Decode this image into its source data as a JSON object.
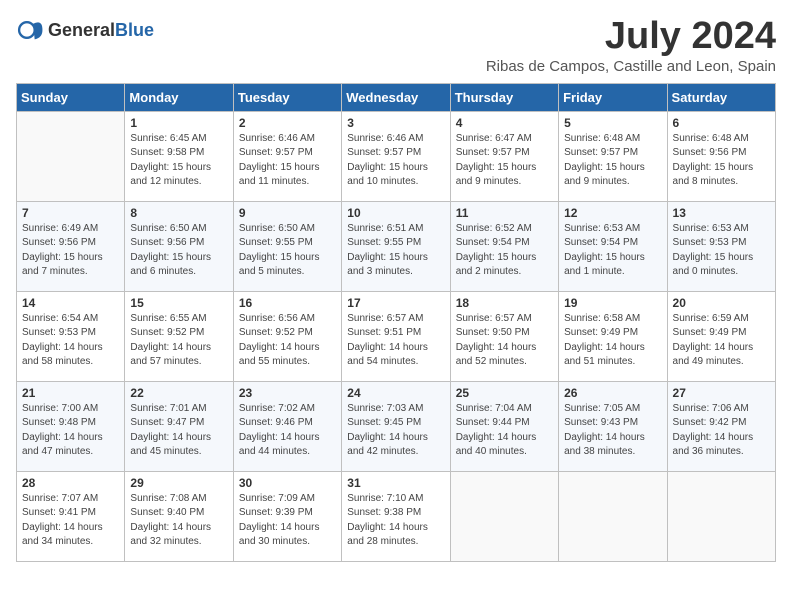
{
  "header": {
    "logo_general": "General",
    "logo_blue": "Blue",
    "month_title": "July 2024",
    "location": "Ribas de Campos, Castille and Leon, Spain"
  },
  "days_of_week": [
    "Sunday",
    "Monday",
    "Tuesday",
    "Wednesday",
    "Thursday",
    "Friday",
    "Saturday"
  ],
  "weeks": [
    [
      {
        "day": "",
        "info": ""
      },
      {
        "day": "1",
        "info": "Sunrise: 6:45 AM\nSunset: 9:58 PM\nDaylight: 15 hours\nand 12 minutes."
      },
      {
        "day": "2",
        "info": "Sunrise: 6:46 AM\nSunset: 9:57 PM\nDaylight: 15 hours\nand 11 minutes."
      },
      {
        "day": "3",
        "info": "Sunrise: 6:46 AM\nSunset: 9:57 PM\nDaylight: 15 hours\nand 10 minutes."
      },
      {
        "day": "4",
        "info": "Sunrise: 6:47 AM\nSunset: 9:57 PM\nDaylight: 15 hours\nand 9 minutes."
      },
      {
        "day": "5",
        "info": "Sunrise: 6:48 AM\nSunset: 9:57 PM\nDaylight: 15 hours\nand 9 minutes."
      },
      {
        "day": "6",
        "info": "Sunrise: 6:48 AM\nSunset: 9:56 PM\nDaylight: 15 hours\nand 8 minutes."
      }
    ],
    [
      {
        "day": "7",
        "info": "Sunrise: 6:49 AM\nSunset: 9:56 PM\nDaylight: 15 hours\nand 7 minutes."
      },
      {
        "day": "8",
        "info": "Sunrise: 6:50 AM\nSunset: 9:56 PM\nDaylight: 15 hours\nand 6 minutes."
      },
      {
        "day": "9",
        "info": "Sunrise: 6:50 AM\nSunset: 9:55 PM\nDaylight: 15 hours\nand 5 minutes."
      },
      {
        "day": "10",
        "info": "Sunrise: 6:51 AM\nSunset: 9:55 PM\nDaylight: 15 hours\nand 3 minutes."
      },
      {
        "day": "11",
        "info": "Sunrise: 6:52 AM\nSunset: 9:54 PM\nDaylight: 15 hours\nand 2 minutes."
      },
      {
        "day": "12",
        "info": "Sunrise: 6:53 AM\nSunset: 9:54 PM\nDaylight: 15 hours\nand 1 minute."
      },
      {
        "day": "13",
        "info": "Sunrise: 6:53 AM\nSunset: 9:53 PM\nDaylight: 15 hours\nand 0 minutes."
      }
    ],
    [
      {
        "day": "14",
        "info": "Sunrise: 6:54 AM\nSunset: 9:53 PM\nDaylight: 14 hours\nand 58 minutes."
      },
      {
        "day": "15",
        "info": "Sunrise: 6:55 AM\nSunset: 9:52 PM\nDaylight: 14 hours\nand 57 minutes."
      },
      {
        "day": "16",
        "info": "Sunrise: 6:56 AM\nSunset: 9:52 PM\nDaylight: 14 hours\nand 55 minutes."
      },
      {
        "day": "17",
        "info": "Sunrise: 6:57 AM\nSunset: 9:51 PM\nDaylight: 14 hours\nand 54 minutes."
      },
      {
        "day": "18",
        "info": "Sunrise: 6:57 AM\nSunset: 9:50 PM\nDaylight: 14 hours\nand 52 minutes."
      },
      {
        "day": "19",
        "info": "Sunrise: 6:58 AM\nSunset: 9:49 PM\nDaylight: 14 hours\nand 51 minutes."
      },
      {
        "day": "20",
        "info": "Sunrise: 6:59 AM\nSunset: 9:49 PM\nDaylight: 14 hours\nand 49 minutes."
      }
    ],
    [
      {
        "day": "21",
        "info": "Sunrise: 7:00 AM\nSunset: 9:48 PM\nDaylight: 14 hours\nand 47 minutes."
      },
      {
        "day": "22",
        "info": "Sunrise: 7:01 AM\nSunset: 9:47 PM\nDaylight: 14 hours\nand 45 minutes."
      },
      {
        "day": "23",
        "info": "Sunrise: 7:02 AM\nSunset: 9:46 PM\nDaylight: 14 hours\nand 44 minutes."
      },
      {
        "day": "24",
        "info": "Sunrise: 7:03 AM\nSunset: 9:45 PM\nDaylight: 14 hours\nand 42 minutes."
      },
      {
        "day": "25",
        "info": "Sunrise: 7:04 AM\nSunset: 9:44 PM\nDaylight: 14 hours\nand 40 minutes."
      },
      {
        "day": "26",
        "info": "Sunrise: 7:05 AM\nSunset: 9:43 PM\nDaylight: 14 hours\nand 38 minutes."
      },
      {
        "day": "27",
        "info": "Sunrise: 7:06 AM\nSunset: 9:42 PM\nDaylight: 14 hours\nand 36 minutes."
      }
    ],
    [
      {
        "day": "28",
        "info": "Sunrise: 7:07 AM\nSunset: 9:41 PM\nDaylight: 14 hours\nand 34 minutes."
      },
      {
        "day": "29",
        "info": "Sunrise: 7:08 AM\nSunset: 9:40 PM\nDaylight: 14 hours\nand 32 minutes."
      },
      {
        "day": "30",
        "info": "Sunrise: 7:09 AM\nSunset: 9:39 PM\nDaylight: 14 hours\nand 30 minutes."
      },
      {
        "day": "31",
        "info": "Sunrise: 7:10 AM\nSunset: 9:38 PM\nDaylight: 14 hours\nand 28 minutes."
      },
      {
        "day": "",
        "info": ""
      },
      {
        "day": "",
        "info": ""
      },
      {
        "day": "",
        "info": ""
      }
    ]
  ]
}
